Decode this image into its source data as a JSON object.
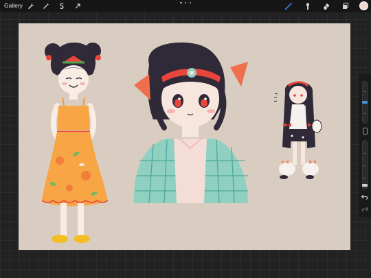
{
  "topbar": {
    "gallery_label": "Gallery",
    "actions": [
      "wrench-icon",
      "magic-wand-icon",
      "selection-icon",
      "transform-icon"
    ],
    "tools": [
      "brush-icon",
      "smudge-icon",
      "eraser-icon",
      "layers-icon"
    ],
    "active_tool": "brush-icon",
    "active_tool_color": "#3a7bd5",
    "current_color": "#f3d7cf"
  },
  "canvas": {
    "background": "#d9cdc2"
  },
  "sidebar": {
    "brush_size_level": 0.5,
    "opacity_level": 0.05
  }
}
